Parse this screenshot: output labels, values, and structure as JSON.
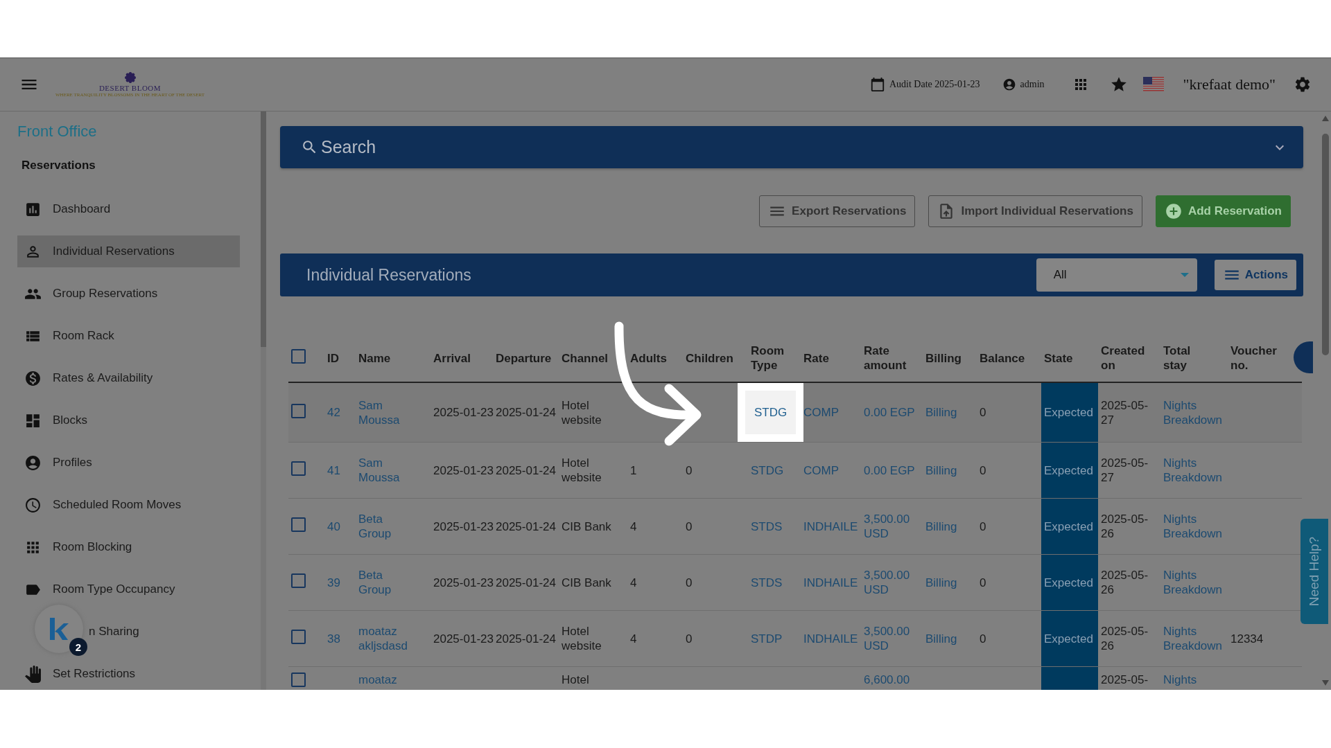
{
  "header": {
    "logo": {
      "name": "DESERT BLOOM",
      "tagline": "WHERE TRANQUILITY BLOSSOMS IN THE HEART OF THE DESERT"
    },
    "audit_date": "Audit Date 2025-01-23",
    "user": "admin",
    "hotel": "\"krefaat demo\""
  },
  "sidebar": {
    "section": "Front Office",
    "group": "Reservations",
    "items": [
      {
        "label": "Dashboard",
        "kind": "full",
        "selected": false
      },
      {
        "label": "Individual Reservations",
        "kind": "full",
        "selected": true
      },
      {
        "label": "Group Reservations",
        "kind": "full",
        "selected": false
      },
      {
        "label": "Room Rack",
        "kind": "full",
        "selected": false
      },
      {
        "label": "Rates & Availability",
        "kind": "full",
        "selected": false
      },
      {
        "label": "Blocks",
        "kind": "full",
        "selected": false
      },
      {
        "label": "Profiles",
        "kind": "full",
        "selected": false
      },
      {
        "label": "Scheduled Room Moves",
        "kind": "full",
        "selected": false
      },
      {
        "label": "Room Blocking",
        "kind": "full",
        "selected": false
      },
      {
        "label": "Room Type Occupancy",
        "kind": "full",
        "selected": false
      },
      {
        "label": "n Sharing",
        "kind": "covered",
        "selected": false
      },
      {
        "label": "Set Restrictions",
        "kind": "full",
        "selected": false
      }
    ]
  },
  "assistant": {
    "badge": "2"
  },
  "search": {
    "label": "Search"
  },
  "toolbar": {
    "buttons": [
      {
        "label": "Export Reservations",
        "kind": "export"
      },
      {
        "label": "Import Individual Reservations",
        "kind": "import"
      },
      {
        "label": "Add Reservation",
        "kind": "add"
      }
    ]
  },
  "panel": {
    "title": "Individual Reservations",
    "filter": "All",
    "actions": "Actions"
  },
  "table": {
    "select_all_checked": false,
    "columns": [
      "ID",
      "Name",
      "Arrival",
      "Departure",
      "Channel",
      "Adults",
      "Children",
      "Room Type",
      "Rate",
      "Rate amount",
      "Billing",
      "Balance",
      "State",
      "Created on",
      "Total stay",
      "Voucher no."
    ],
    "rows": [
      {
        "kind": "full",
        "checked": false,
        "highlighted": true,
        "cells": [
          "42",
          "Sam Moussa",
          "2025-01-23",
          "2025-01-24",
          "Hotel website",
          "",
          "",
          "STDG",
          "COMP",
          "0.00 EGP",
          "Billing",
          "0",
          "Expected",
          "2025-05-27",
          "Nights Breakdown",
          ""
        ]
      },
      {
        "kind": "full",
        "checked": false,
        "highlighted": false,
        "cells": [
          "41",
          "Sam Moussa",
          "2025-01-23",
          "2025-01-24",
          "Hotel website",
          "1",
          "0",
          "STDG",
          "COMP",
          "0.00 EGP",
          "Billing",
          "0",
          "Expected",
          "2025-05-27",
          "Nights Breakdown",
          ""
        ]
      },
      {
        "kind": "full",
        "checked": false,
        "highlighted": false,
        "cells": [
          "40",
          "Beta Group",
          "2025-01-23",
          "2025-01-24",
          "CIB Bank",
          "4",
          "0",
          "STDS",
          "INDHAILE",
          "3,500.00 USD",
          "Billing",
          "0",
          "Expected",
          "2025-05-26",
          "Nights Breakdown",
          ""
        ]
      },
      {
        "kind": "full",
        "checked": false,
        "highlighted": false,
        "cells": [
          "39",
          "Beta Group",
          "2025-01-23",
          "2025-01-24",
          "CIB Bank",
          "4",
          "0",
          "STDS",
          "INDHAILE",
          "3,500.00 USD",
          "Billing",
          "0",
          "Expected",
          "2025-05-26",
          "Nights Breakdown",
          ""
        ]
      },
      {
        "kind": "full",
        "checked": false,
        "highlighted": false,
        "cells": [
          "38",
          "moataz akljsdasd",
          "2025-01-23",
          "2025-01-24",
          "Hotel website",
          "4",
          "0",
          "STDP",
          "INDHAILE",
          "3,500.00 USD",
          "Billing",
          "0",
          "Expected",
          "2025-05-26",
          "Nights Breakdown",
          "12334"
        ]
      },
      {
        "kind": "partial",
        "checked": false,
        "highlighted": false,
        "cells": [
          "",
          "moataz",
          "",
          "",
          "Hotel",
          "",
          "",
          "",
          "",
          "6,600.00",
          "",
          "",
          "",
          "2025-05-",
          "Nights",
          ""
        ]
      }
    ]
  },
  "help": {
    "label": "Need Help?"
  }
}
